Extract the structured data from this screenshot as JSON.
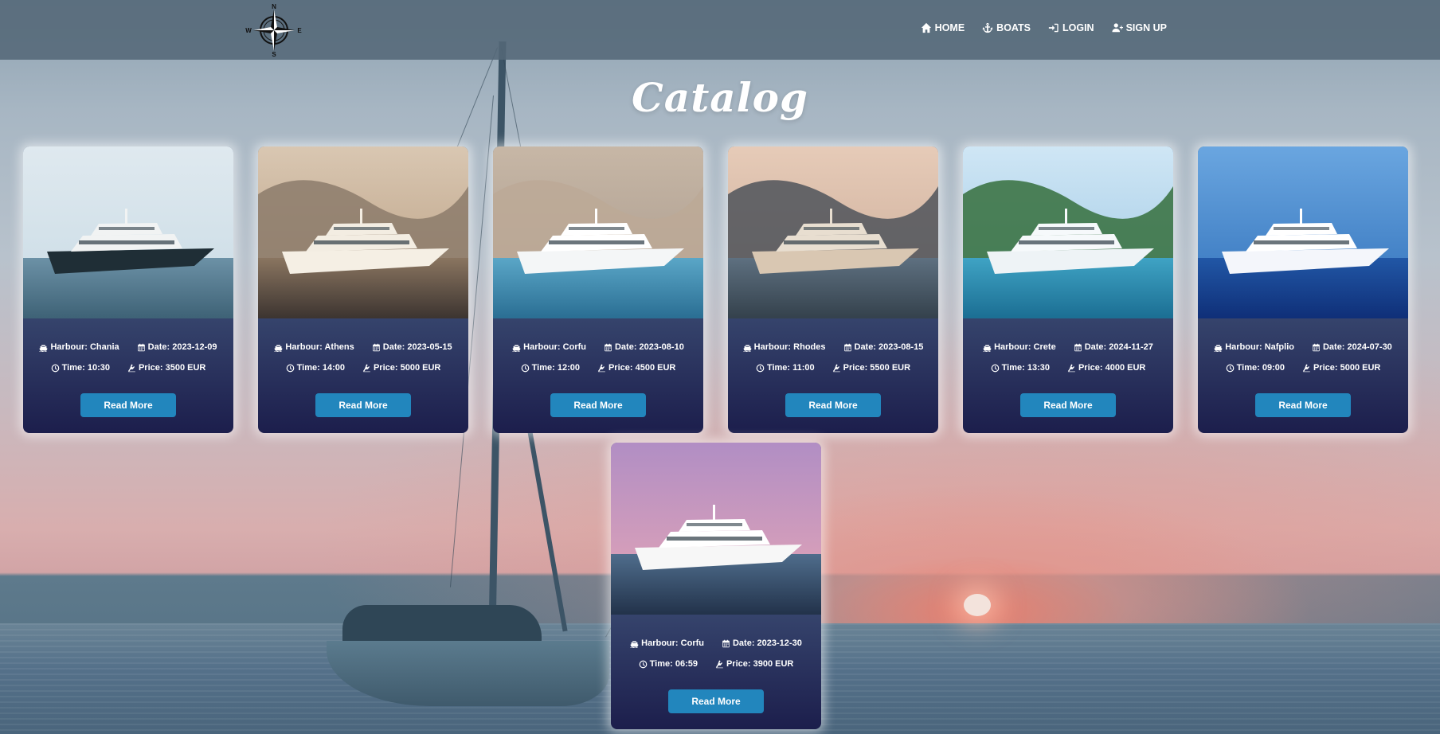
{
  "header": {
    "logo_letters": {
      "n": "N",
      "s": "S",
      "e": "E",
      "w": "W"
    },
    "nav": [
      {
        "label": "HOME",
        "icon": "home-icon"
      },
      {
        "label": "BOATS",
        "icon": "anchor-icon"
      },
      {
        "label": "LOGIN",
        "icon": "login-icon"
      },
      {
        "label": "SIGN UP",
        "icon": "user-plus-icon"
      }
    ]
  },
  "main": {
    "title": "Catalog",
    "read_more_label": "Read More",
    "cards": [
      {
        "harbour": "Harbour: Chania",
        "date": "Date: 2023-12-09",
        "time": "Time: 10:30",
        "price": "Price: 3500 EUR",
        "button": "Read More"
      },
      {
        "harbour": "Harbour: Athens",
        "date": "Date: 2023-05-15",
        "time": "Time: 14:00",
        "price": "Price: 5000 EUR",
        "button": "Read More"
      },
      {
        "harbour": "Harbour: Corfu",
        "date": "Date: 2023-08-10",
        "time": "Time: 12:00",
        "price": "Price: 4500 EUR",
        "button": "Read More"
      },
      {
        "harbour": "Harbour: Rhodes",
        "date": "Date: 2023-08-15",
        "time": "Time: 11:00",
        "price": "Price: 5500 EUR",
        "button": "Read More"
      },
      {
        "harbour": "Harbour: Crete",
        "date": "Date: 2024-11-27",
        "time": "Time: 13:30",
        "price": "Price: 4000 EUR",
        "button": "Read More"
      },
      {
        "harbour": "Harbour: Nafplio",
        "date": "Date: 2024-07-30",
        "time": "Time: 09:00",
        "price": "Price: 5000 EUR",
        "button": "Read More"
      },
      {
        "harbour": "Harbour: Corfu",
        "date": "Date: 2023-12-30",
        "time": "Time: 06:59",
        "price": "Price: 3900 EUR",
        "button": "Read More"
      }
    ]
  },
  "colors": {
    "button": "#2286bd",
    "card_top": "#56708e",
    "card_bottom": "#1c1e4c",
    "navbar": "#546878"
  }
}
